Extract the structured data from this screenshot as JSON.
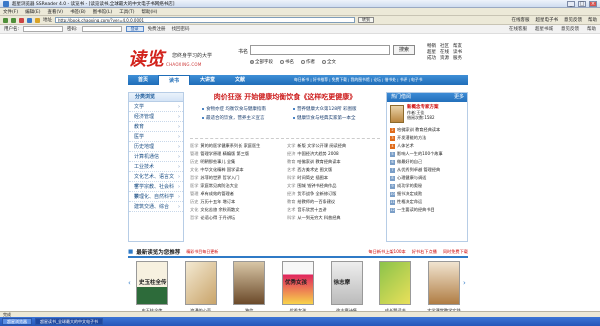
{
  "window": {
    "title": "超星浏览器 SSReader 4.0 - 读览书 - [读览读书,全球最大的中文电子书网络书店]",
    "min": "_",
    "max": "□",
    "close": "×"
  },
  "menu": [
    "文件(F)",
    "编辑(E)",
    "查看(V)",
    "书签(B)",
    "图书馆(L)",
    "工具(T)",
    "帮助(H)"
  ],
  "addressbar": {
    "label": "地址",
    "url": "http://book.chaoxing.com/?ver=4.0.0.0001",
    "go": "转到",
    "right_links": [
      "在线客服",
      "超星电子书",
      "意见反馈",
      "帮助"
    ]
  },
  "topstrip": {
    "user_label": "用户名:",
    "pwd_label": "密码:",
    "login": "登录",
    "links": [
      "免费注册",
      "找回密码"
    ],
    "right_links": [
      "在线客服",
      "超星书城",
      "意见反馈",
      "帮助"
    ]
  },
  "brand": {
    "mark": "读览",
    "slogan": "您终身学习的大学",
    "domain": "CHAOXING.COM"
  },
  "search": {
    "label": "书名",
    "button": "搜索",
    "options": [
      "全部字段",
      "书名",
      "作者",
      "全文"
    ]
  },
  "userbox": {
    "lines": [
      [
        "畅销",
        "社区",
        "帮友"
      ],
      [
        "超星",
        "在线",
        "读书"
      ],
      [
        "成功",
        "资源",
        "服务"
      ]
    ]
  },
  "nav": {
    "tabs": [
      "首页",
      "读书",
      "大讲堂",
      "文献"
    ],
    "sub": "每日新书 | 好书推荐 | 免费下载 | 我的图书馆 | 论坛 | 借书处 | 书评 | 电子书"
  },
  "leftcat": {
    "title": "分类浏览",
    "items": [
      "文学",
      "经济管理",
      "教育",
      "医学",
      "历史地理",
      "计算机通信",
      "工业技术",
      "文化艺术、语言文字",
      "哲学宗教、社会科学",
      "数理化、自然科学",
      "建筑交通、综合"
    ]
  },
  "center": {
    "headline": "肉价狂涨 开始健康均衡饮食《这样吃更健康》",
    "featured": [
      "食物亦症 均衡饮食与健康指南",
      "营养健康大众第128所 彩图版",
      "最适合的饮食，营养主义宣言",
      "健康饮食与经典实家第一本全"
    ],
    "lists": [
      [
        "医学",
        "黄的的医学健康系列长 家庭医生"
      ],
      [
        "文学",
        "新版 文学公开课 阅读经典"
      ],
      [
        "管理",
        "管理学原理 精编版 第三版"
      ],
      [
        "经济",
        "中国经济大趋势 2008"
      ],
      [
        "历史",
        "明朝那些事儿 全集"
      ],
      [
        "教育",
        "哈佛家训 教育经典读本"
      ],
      [
        "文化",
        "中华文化精粹 国学读本"
      ],
      [
        "艺术",
        "西方美术史 图文版"
      ],
      [
        "哲学",
        "苏菲的世界 哲学入门"
      ],
      [
        "科学",
        "时间简史 插图本"
      ],
      [
        "医学",
        "家庭常见病防治大全"
      ],
      [
        "文学",
        "围城 钱钟书经典作品"
      ],
      [
        "管理",
        "卓有成效的管理者"
      ],
      [
        "经济",
        "货币战争 全新修订版"
      ],
      [
        "历史",
        "万历十五年 增订本"
      ],
      [
        "教育",
        "给教师的一百条建议"
      ],
      [
        "文化",
        "文化苦旅 余秋雨散文"
      ],
      [
        "艺术",
        "音乐欣赏十五讲"
      ],
      [
        "哲学",
        "论语心得 于丹讲坛"
      ],
      [
        "科学",
        "从一到无穷大 科普经典"
      ]
    ]
  },
  "rightcol": {
    "title": "热门借阅",
    "more": "更多",
    "top": {
      "title": "新概念专家方案",
      "line1": "作者:王佳",
      "line2": "借阅次数:1582"
    },
    "items": [
      "哈佛家训 教育经典读本",
      "开发潜能的方法",
      "人体艺术",
      "影响人一生的100个故事",
      "做最好的自己",
      "从优秀到卓越 管理经典",
      "心理健康与调适",
      "成功学的奥秘",
      "细节决定成败",
      "性格决定命运",
      "一生要读的经典书目"
    ]
  },
  "recommend": {
    "title": "最新读览为您推荐",
    "marquee": "精彩书目每日更新",
    "links": [
      "每日新书上架100本",
      "好书右下点播",
      "同时免费下载"
    ],
    "prev": "‹",
    "next": "›",
    "books": [
      {
        "caption": "史玉柱全传",
        "cover_text": "史玉柱全传"
      },
      {
        "caption": "浪漫的心声",
        "cover_text": ""
      },
      {
        "caption": "独信",
        "cover_text": ""
      },
      {
        "caption": "优秀女孩",
        "cover_text": "优秀女孩"
      },
      {
        "caption": "徐志摩诗集",
        "cover_text": "徐志摩"
      },
      {
        "caption": "成长赞读书",
        "cover_text": ""
      },
      {
        "caption": "大学课堂教学实践",
        "cover_text": ""
      }
    ]
  },
  "status": "完成",
  "taskbar": [
    "超星浏览器",
    "超星读书_全球最大的中文电子书"
  ]
}
